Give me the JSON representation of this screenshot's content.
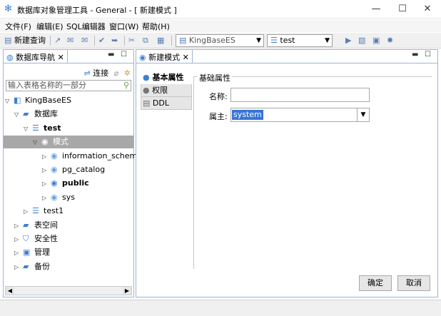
{
  "window": {
    "title": "数据库对象管理工具 - General - [ 新建模式 ]",
    "minimize": "—",
    "maximize": "☐",
    "close": "✕"
  },
  "menu": [
    "文件(F)",
    "编辑(E)",
    "SQL编辑器",
    "窗口(W)",
    "帮助(H)"
  ],
  "toolbar": {
    "new_query": "新建查询",
    "connection_combo": "KingBaseES",
    "database_combo": "test"
  },
  "navigator": {
    "tab_label": "数据库导航",
    "connect_label": "连接",
    "search_placeholder": "输入表格名称的一部分",
    "tree": [
      {
        "label": "KingBaseES",
        "level": 0,
        "expanded": true
      },
      {
        "label": "数据库",
        "level": 1,
        "expanded": true
      },
      {
        "label": "test",
        "level": 2,
        "expanded": true,
        "bold": true
      },
      {
        "label": "模式",
        "level": 3,
        "expanded": true,
        "selected": true
      },
      {
        "label": "information_schema",
        "level": 4
      },
      {
        "label": "pg_catalog",
        "level": 4
      },
      {
        "label": "public",
        "level": 4,
        "bold": true
      },
      {
        "label": "sys",
        "level": 4
      },
      {
        "label": "test1",
        "level": 2
      },
      {
        "label": "表空间",
        "level": 1
      },
      {
        "label": "安全性",
        "level": 1
      },
      {
        "label": "管理",
        "level": 1
      },
      {
        "label": "备份",
        "level": 1
      }
    ]
  },
  "editor": {
    "tab_label": "新建模式",
    "side_tabs": [
      "基本属性",
      "权限",
      "DDL"
    ],
    "group_title": "基础属性",
    "name_label": "名称:",
    "name_value": "",
    "owner_label": "属主:",
    "owner_value": "system",
    "ok_button": "确定",
    "cancel_button": "取消"
  },
  "colors": {
    "accent": "#3c7fd3",
    "selection": "#a8a8a8",
    "panel_border": "#9eb6d4"
  }
}
